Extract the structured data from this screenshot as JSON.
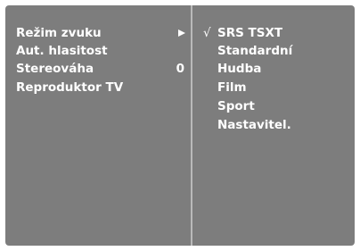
{
  "menu": {
    "items": [
      {
        "label": "Režim zvuku",
        "value": null,
        "has_submenu": true,
        "selected": true
      },
      {
        "label": "Aut. hlasitost",
        "value": null,
        "has_submenu": false,
        "selected": false
      },
      {
        "label": "Stereováha",
        "value": "0",
        "has_submenu": false,
        "selected": false
      },
      {
        "label": "Reproduktor TV",
        "value": null,
        "has_submenu": false,
        "selected": false
      }
    ],
    "submenu_arrow_icon": "triangle-right-icon"
  },
  "submenu": {
    "check_mark": "√",
    "options": [
      {
        "label": "SRS TSXT",
        "checked": true
      },
      {
        "label": "Standardní",
        "checked": false
      },
      {
        "label": "Hudba",
        "checked": false
      },
      {
        "label": "Film",
        "checked": false
      },
      {
        "label": "Sport",
        "checked": false
      },
      {
        "label": "Nastavitel.",
        "checked": false
      }
    ]
  },
  "colors": {
    "background": "#7d7d7d",
    "text": "#ffffff",
    "divider": "#b9b9b9"
  }
}
